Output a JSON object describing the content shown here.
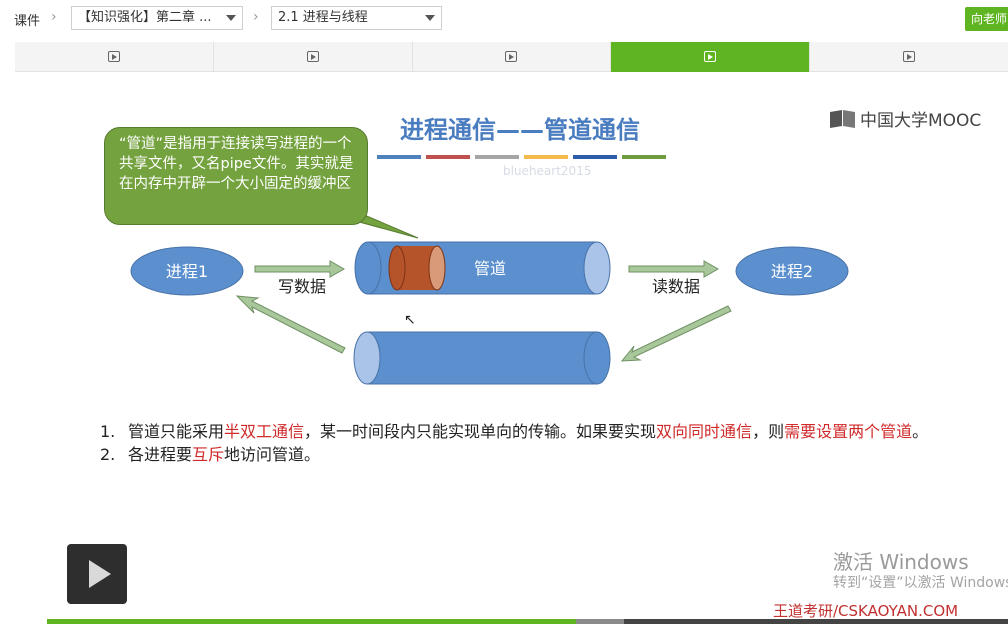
{
  "topbar": {
    "courseware_label": "课件",
    "chapter_select": "【知识强化】第二章 ...",
    "section_select": "2.1 进程与线程",
    "ask_button": "向老师"
  },
  "tabs": [
    {
      "icon": "video-icon",
      "active": false
    },
    {
      "icon": "video-icon",
      "active": false
    },
    {
      "icon": "video-icon",
      "active": false
    },
    {
      "icon": "video-icon",
      "active": true
    },
    {
      "icon": "video-icon",
      "active": false
    }
  ],
  "slide": {
    "title": "进程通信——管道通信",
    "watermark": "blueheart2015",
    "logo_text": "中国大学MOOC",
    "callout": "“管道”是指用于连接读写进程的一个共享文件，又名pipe文件。其实就是在内存中开辟一个大小固定的缓冲区",
    "process1": "进程1",
    "process2": "进程2",
    "pipe_label": "管道",
    "write_label": "写数据",
    "read_label": "读数据",
    "color_bar": [
      "#4f81bd",
      "#c0504d",
      "#a5a5a5",
      "#f3b94a",
      "#2e5cad",
      "#6e9b3d"
    ],
    "notes": [
      {
        "num": "1.",
        "parts": [
          {
            "t": "管道只能采用",
            "red": false
          },
          {
            "t": "半双工通信",
            "red": true
          },
          {
            "t": "，某一时间段内只能实现单向的传输。如果要实现",
            "red": false
          },
          {
            "t": "双向同时通信",
            "red": true
          },
          {
            "t": "，则",
            "red": false
          },
          {
            "t": "需要设置两个管道",
            "red": true
          },
          {
            "t": "。",
            "red": false
          }
        ]
      },
      {
        "num": "2.",
        "parts": [
          {
            "t": "各进程要",
            "red": false
          },
          {
            "t": "互斥",
            "red": true
          },
          {
            "t": "地访问管道。",
            "red": false
          }
        ]
      }
    ]
  },
  "overlay": {
    "activate_title": "激活 Windows",
    "activate_sub": "转到“设置”以激活 Windows。",
    "brand": "王道考研/CSKAOYAN.COM"
  },
  "player": {
    "played_fraction": 0.55,
    "buffered_fraction": 0.6
  },
  "colors": {
    "accent_green": "#5fb521",
    "title_blue": "#4a7cc0",
    "highlight_red": "#d02a2a",
    "pipe_blue": "#5b8fce"
  }
}
